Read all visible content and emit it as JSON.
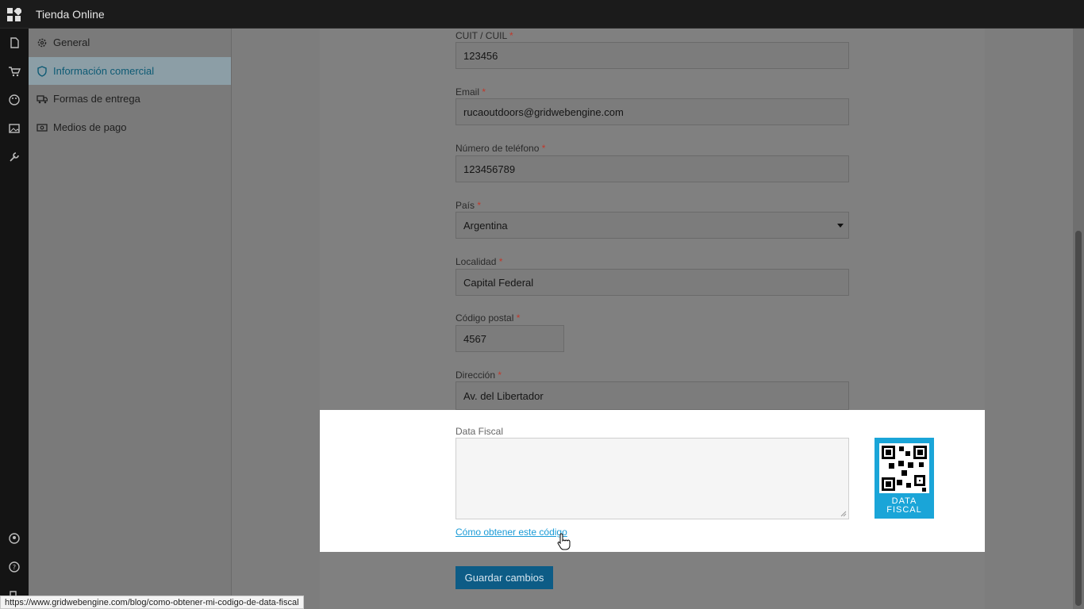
{
  "header": {
    "title": "Tienda Online"
  },
  "rail": {
    "icons": [
      "apps-grid-icon",
      "page-icon",
      "cart-icon",
      "palette-icon",
      "image-icon",
      "tools-icon",
      "user-icon",
      "help-icon",
      "exit-icon"
    ]
  },
  "sidebar": {
    "items": [
      {
        "label": "General",
        "icon": "gear-icon",
        "active": false
      },
      {
        "label": "Información comercial",
        "icon": "shield-icon",
        "active": true
      },
      {
        "label": "Formas de entrega",
        "icon": "truck-icon",
        "active": false
      },
      {
        "label": "Medios de pago",
        "icon": "money-icon",
        "active": false
      }
    ]
  },
  "form": {
    "cuit": {
      "label": "CUIT / CUIL",
      "value": "123456"
    },
    "email": {
      "label": "Email",
      "value": "rucaoutdoors@gridwebengine.com"
    },
    "phone": {
      "label": "Número de teléfono",
      "value": "123456789"
    },
    "country": {
      "label": "País",
      "value": "Argentina"
    },
    "city": {
      "label": "Localidad",
      "value": "Capital Federal"
    },
    "zip": {
      "label": "Código postal",
      "value": "4567"
    },
    "address": {
      "label": "Dirección",
      "value": "Av. del Libertador"
    },
    "required_mark": "*",
    "data_fiscal": {
      "label": "Data Fiscal",
      "value": "",
      "link": "Cómo obtener este código",
      "badge_line1": "DATA",
      "badge_line2": "FISCAL"
    },
    "save_label": "Guardar cambios"
  },
  "statusbar": {
    "url": "https://www.gridwebengine.com/blog/como-obtener-mi-codigo-de-data-fiscal"
  },
  "colors": {
    "accent": "#1a9bd7",
    "button": "#0d5c86",
    "topbar": "#1b1b1b",
    "qr_bg": "#1aa5d8"
  }
}
